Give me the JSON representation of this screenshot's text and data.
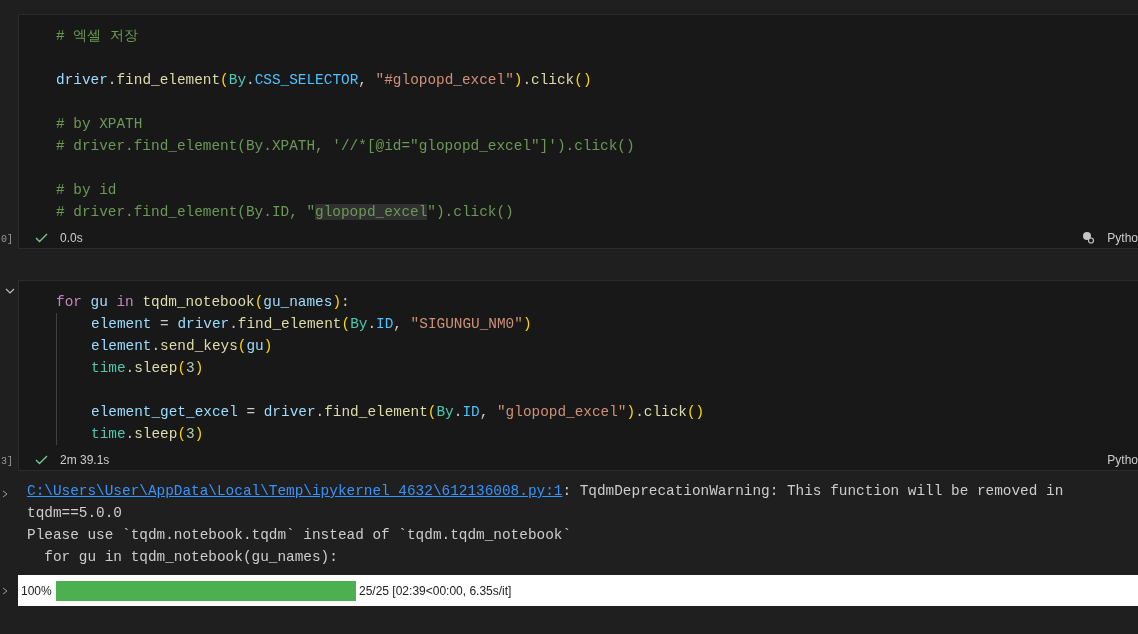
{
  "cells": [
    {
      "execution_count": "0]",
      "collapse_toggle": false,
      "kernel_icon": true,
      "language": "Pytho",
      "status": "0.0s",
      "lines": [
        {
          "kind": "code",
          "tokens": [
            {
              "t": "# 엑셀 저장",
              "kind": "comment"
            }
          ]
        },
        {
          "kind": "blank"
        },
        {
          "kind": "code",
          "tokens": [
            {
              "t": "driver",
              "kind": "var"
            },
            {
              "t": ".",
              "kind": "plain"
            },
            {
              "t": "find_element",
              "kind": "fn"
            },
            {
              "t": "(",
              "kind": "paren"
            },
            {
              "t": "By",
              "kind": "class"
            },
            {
              "t": ".",
              "kind": "plain"
            },
            {
              "t": "CSS_SELECTOR",
              "kind": "const"
            },
            {
              "t": ", ",
              "kind": "plain"
            },
            {
              "t": "\"#glopopd_excel\"",
              "kind": "str"
            },
            {
              "t": ")",
              "kind": "paren"
            },
            {
              "t": ".",
              "kind": "plain"
            },
            {
              "t": "click",
              "kind": "fn"
            },
            {
              "t": "()",
              "kind": "paren"
            }
          ]
        },
        {
          "kind": "blank"
        },
        {
          "kind": "code",
          "tokens": [
            {
              "t": "# by XPATH",
              "kind": "comment"
            }
          ]
        },
        {
          "kind": "code",
          "tokens": [
            {
              "t": "# driver.find_element(By.XPATH, '//*[@id=\"glopopd_excel\"]').click()",
              "kind": "comment"
            }
          ]
        },
        {
          "kind": "blank"
        },
        {
          "kind": "code",
          "tokens": [
            {
              "t": "# by id",
              "kind": "comment"
            }
          ]
        },
        {
          "kind": "code",
          "tokens": [
            {
              "t": "# driver.find_element(By.ID, \"",
              "kind": "comment"
            },
            {
              "t": "glopopd_excel",
              "kind": "comment",
              "highlight": true
            },
            {
              "t": "\").click()",
              "kind": "comment"
            }
          ]
        }
      ]
    },
    {
      "execution_count": "3]",
      "collapse_toggle": true,
      "kernel_icon": false,
      "language": "Pytho",
      "status": "2m 39.1s",
      "lines": [
        {
          "kind": "code",
          "tokens": [
            {
              "t": "for ",
              "kind": "kw"
            },
            {
              "t": "gu ",
              "kind": "var"
            },
            {
              "t": "in ",
              "kind": "kw"
            },
            {
              "t": "tqdm_notebook",
              "kind": "fn"
            },
            {
              "t": "(",
              "kind": "paren"
            },
            {
              "t": "gu_names",
              "kind": "var"
            },
            {
              "t": ")",
              "kind": "paren"
            },
            {
              "t": ":",
              "kind": "plain"
            }
          ]
        },
        {
          "kind": "indented",
          "tokens": [
            {
              "t": "element",
              "kind": "var"
            },
            {
              "t": " = ",
              "kind": "plain"
            },
            {
              "t": "driver",
              "kind": "var"
            },
            {
              "t": ".",
              "kind": "plain"
            },
            {
              "t": "find_element",
              "kind": "fn"
            },
            {
              "t": "(",
              "kind": "paren"
            },
            {
              "t": "By",
              "kind": "class"
            },
            {
              "t": ".",
              "kind": "plain"
            },
            {
              "t": "ID",
              "kind": "const"
            },
            {
              "t": ", ",
              "kind": "plain"
            },
            {
              "t": "\"SIGUNGU_NM0\"",
              "kind": "str"
            },
            {
              "t": ")",
              "kind": "paren"
            }
          ]
        },
        {
          "kind": "indented",
          "tokens": [
            {
              "t": "element",
              "kind": "var"
            },
            {
              "t": ".",
              "kind": "plain"
            },
            {
              "t": "send_keys",
              "kind": "fn"
            },
            {
              "t": "(",
              "kind": "paren"
            },
            {
              "t": "gu",
              "kind": "var"
            },
            {
              "t": ")",
              "kind": "paren"
            }
          ]
        },
        {
          "kind": "indented",
          "tokens": [
            {
              "t": "time",
              "kind": "class"
            },
            {
              "t": ".",
              "kind": "plain"
            },
            {
              "t": "sleep",
              "kind": "fn"
            },
            {
              "t": "(",
              "kind": "paren"
            },
            {
              "t": "3",
              "kind": "num"
            },
            {
              "t": ")",
              "kind": "paren"
            }
          ]
        },
        {
          "kind": "indented-blank"
        },
        {
          "kind": "indented",
          "tokens": [
            {
              "t": "element_get_excel",
              "kind": "var"
            },
            {
              "t": " = ",
              "kind": "plain"
            },
            {
              "t": "driver",
              "kind": "var"
            },
            {
              "t": ".",
              "kind": "plain"
            },
            {
              "t": "find_element",
              "kind": "fn"
            },
            {
              "t": "(",
              "kind": "paren"
            },
            {
              "t": "By",
              "kind": "class"
            },
            {
              "t": ".",
              "kind": "plain"
            },
            {
              "t": "ID",
              "kind": "const"
            },
            {
              "t": ", ",
              "kind": "plain"
            },
            {
              "t": "\"glopopd_excel\"",
              "kind": "str"
            },
            {
              "t": ")",
              "kind": "paren"
            },
            {
              "t": ".",
              "kind": "plain"
            },
            {
              "t": "click",
              "kind": "fn"
            },
            {
              "t": "()",
              "kind": "paren"
            }
          ]
        },
        {
          "kind": "indented",
          "tokens": [
            {
              "t": "time",
              "kind": "class"
            },
            {
              "t": ".",
              "kind": "plain"
            },
            {
              "t": "sleep",
              "kind": "fn"
            },
            {
              "t": "(",
              "kind": "paren"
            },
            {
              "t": "3",
              "kind": "num"
            },
            {
              "t": ")",
              "kind": "paren"
            }
          ]
        }
      ]
    }
  ],
  "output": {
    "lines": [
      {
        "link": "C:\\Users\\User\\AppData\\Local\\Temp\\ipykernel_4632\\612136008.py:1",
        "text": ": TqdmDeprecationWarning: This function will be removed in"
      },
      {
        "text": "tqdm==5.0.0"
      },
      {
        "text": "Please use `tqdm.notebook.tqdm` instead of `tqdm.tqdm_notebook`"
      },
      {
        "text": "  for gu in tqdm_notebook(gu_names):"
      }
    ],
    "progress": {
      "percent": "100%",
      "level": 1.0,
      "summary": "25/25 [02:39<00:00, 6.35s/it]"
    }
  }
}
